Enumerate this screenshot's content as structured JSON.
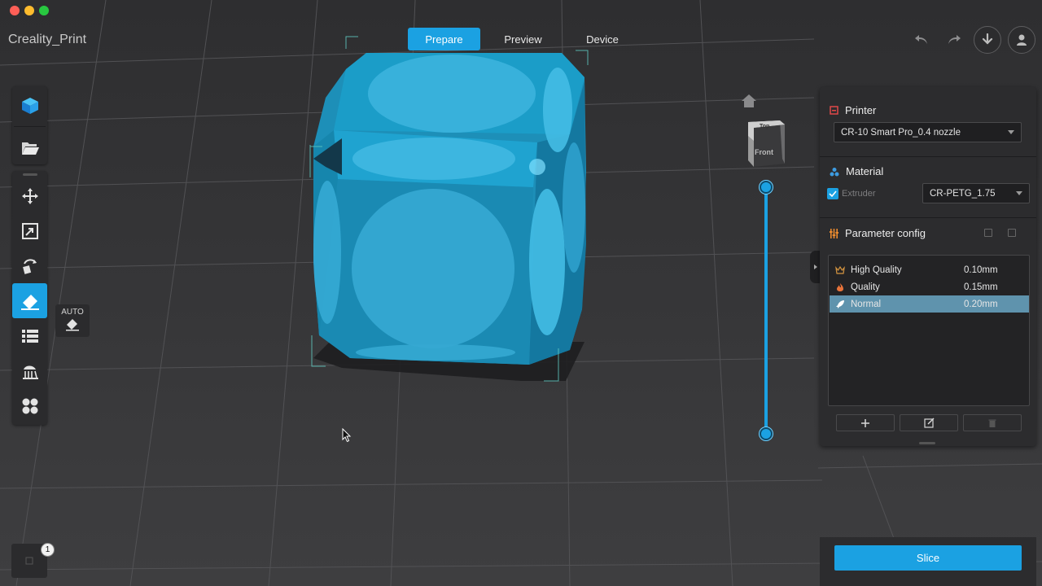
{
  "app": {
    "title": "Creality_Print"
  },
  "tabs": [
    {
      "label": "Prepare",
      "active": true
    },
    {
      "label": "Preview",
      "active": false
    },
    {
      "label": "Device",
      "active": false
    }
  ],
  "top_right_icons": [
    "undo-icon",
    "redo-icon",
    "download-icon",
    "user-icon"
  ],
  "left_toolbar": {
    "group1": [
      "model-cube-icon",
      "open-folder-icon"
    ],
    "group2": [
      "move-icon",
      "scale-icon",
      "rotate-icon",
      "lay-flat-icon",
      "layers-list-icon",
      "support-icon",
      "arrange-icon"
    ],
    "active_tool": "lay-flat-icon"
  },
  "auto_button": {
    "label": "AUTO"
  },
  "view_cube": {
    "top_label": "Top",
    "front_label": "Front"
  },
  "panel": {
    "printer": {
      "title": "Printer",
      "selected": "CR-10 Smart Pro_0.4 nozzle"
    },
    "material": {
      "title": "Material",
      "extruder_label": "Extruder",
      "extruder_checked": true,
      "selected": "CR-PETG_1.75"
    },
    "parameter_config": {
      "title": "Parameter config",
      "rows": [
        {
          "name": "High Quality",
          "value": "0.10mm",
          "icon": "crown-icon",
          "selected": false
        },
        {
          "name": "Quality",
          "value": "0.15mm",
          "icon": "flame-icon",
          "selected": false
        },
        {
          "name": "Normal",
          "value": "0.20mm",
          "icon": "rocket-icon",
          "selected": true
        }
      ]
    }
  },
  "slice": {
    "label": "Slice"
  },
  "object_count": "1",
  "colors": {
    "accent": "#1ba1e2",
    "model": "#1e8fb5",
    "background": "#3a3a3c",
    "panel": "#2c2c2e"
  }
}
